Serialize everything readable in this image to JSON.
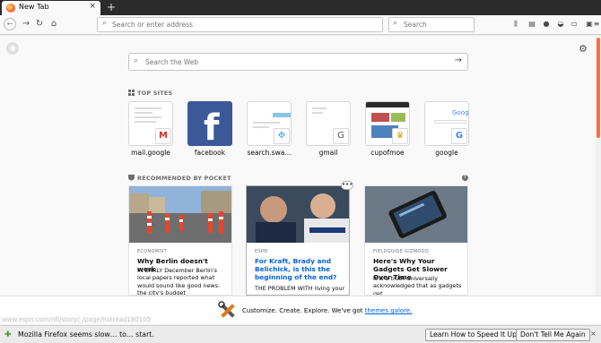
{
  "tab": {
    "title": "New Tab",
    "close": "×",
    "new_tab": "+"
  },
  "nav": {
    "back": "←",
    "forward": "→",
    "reload": "↻",
    "home": "⌂",
    "address_placeholder": "Search or enter address",
    "search_placeholder": "Search",
    "toolbar_icons": [
      "library-icon",
      "sidebar-icon",
      "account-icon",
      "pocket-icon",
      "reader-icon",
      "extension-icon",
      "menu-icon"
    ]
  },
  "page": {
    "web_search_placeholder": "Search the Web",
    "top_sites_heading": "TOP SITES",
    "top_sites": [
      {
        "label": "mail.google",
        "favicon": "M"
      },
      {
        "label": "facebook",
        "favicon": "f"
      },
      {
        "label": "search.swa...",
        "favicon": ""
      },
      {
        "label": "gmail",
        "favicon": "G"
      },
      {
        "label": "cupofmoe",
        "favicon": ""
      },
      {
        "label": "google",
        "favicon": "G"
      }
    ],
    "pocket_heading": "RECOMMENDED BY POCKET",
    "pocket_help": "?",
    "stories": [
      {
        "source": "ECONOMIST",
        "headline": "Why Berlin doesn't work",
        "excerpt": "IN EARLY December Berlin's local papers reported what would sound like good news: the city's budget"
      },
      {
        "source": "ESPN",
        "headline": "For Kraft, Brady and Belichick, is this the beginning of the end?",
        "excerpt": "THE PROBLEM WITH living your"
      },
      {
        "source": "FIELDGUIDE.GIZMODO",
        "headline": "Here's Why Your Gadgets Get Slower Over Time",
        "excerpt": "It is a truth universally acknowledged that as gadgets get"
      }
    ],
    "more_dots": "•••"
  },
  "snippet": {
    "text": "Customize. Create. Explore. We've got ",
    "link": "themes galore."
  },
  "status_url": "www.espn.com/nfl/story/_/page/hotread180105",
  "notification": {
    "message": "Mozilla Firefox seems slow… to… start.",
    "button_primary": "Learn How to Speed It Up",
    "button_secondary": "Don't Tell Me Again",
    "close": "×"
  },
  "colors": {
    "accent": "#ff7139",
    "link": "#0060df",
    "facebook": "#3b5998"
  }
}
